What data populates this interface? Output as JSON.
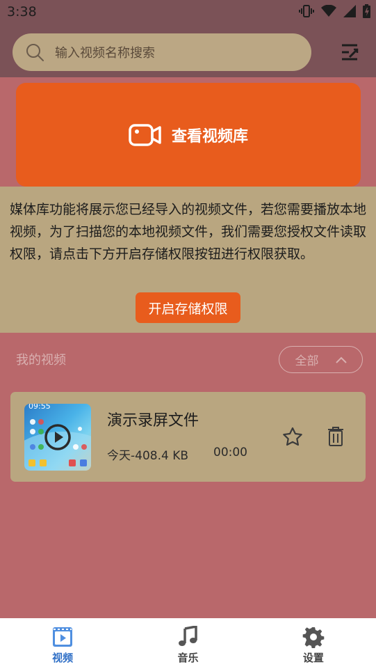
{
  "status": {
    "time": "3:38"
  },
  "search": {
    "placeholder": "输入视频名称搜索"
  },
  "library_button": {
    "label": "查看视频库"
  },
  "permission": {
    "text": "媒体库功能将展示您已经导入的视频文件，若您需要播放本地视频，为了扫描您的本地视频文件，我们需要您授权文件读取权限，请点击下方开启存储权限按钮进行权限获取。",
    "button_label": "开启存储权限"
  },
  "my_videos": {
    "title": "我的视频",
    "filter_label": "全部",
    "items": [
      {
        "title": "演示录屏文件",
        "meta": "今天-408.4 KB",
        "duration": "00:00",
        "thumb_time": "09:55"
      }
    ]
  },
  "bottom_nav": {
    "items": [
      {
        "label": "视频",
        "icon": "video-icon",
        "active": true
      },
      {
        "label": "音乐",
        "icon": "music-note-icon",
        "active": false
      },
      {
        "label": "设置",
        "icon": "gear-icon",
        "active": false
      }
    ]
  },
  "colors": {
    "accent": "#e85c1d",
    "nav_active": "#2f6fc6",
    "page_background": "#b9686b",
    "header_background": "#7b5257",
    "card_background": "#b9a680"
  }
}
